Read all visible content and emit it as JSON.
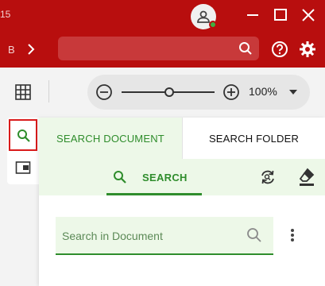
{
  "titlebar": {
    "fragment_text": "15"
  },
  "header": {
    "breadcrumb_fragment": "B",
    "search": {
      "value": "",
      "placeholder": ""
    }
  },
  "toolbar": {
    "zoom_level": "100%"
  },
  "panel": {
    "tabs": [
      {
        "label": "SEARCH DOCUMENT",
        "active": true
      },
      {
        "label": "SEARCH FOLDER",
        "active": false
      }
    ],
    "search_action_label": "SEARCH",
    "search_field": {
      "value": "",
      "placeholder": "Search in Document"
    }
  },
  "colors": {
    "brand_red": "#b80e0e",
    "accent_green": "#2f8d2c",
    "active_tab_bg": "#edf8e8",
    "selection_outline": "#d91b1b",
    "online_status": "#3fb040"
  },
  "icons": {
    "window": [
      "avatar-icon",
      "minimize-icon",
      "maximize-icon",
      "close-icon"
    ],
    "header": [
      "chevron-right-icon",
      "search-icon",
      "help-icon",
      "gear-icon"
    ],
    "toolbar": [
      "grid-icon",
      "zoom-out-icon",
      "zoom-in-icon",
      "caret-down-icon"
    ],
    "side": [
      "search-icon",
      "thumbnails-icon"
    ],
    "panel": [
      "search-icon",
      "refresh-icon",
      "eraser-icon",
      "more-vertical-icon"
    ]
  }
}
